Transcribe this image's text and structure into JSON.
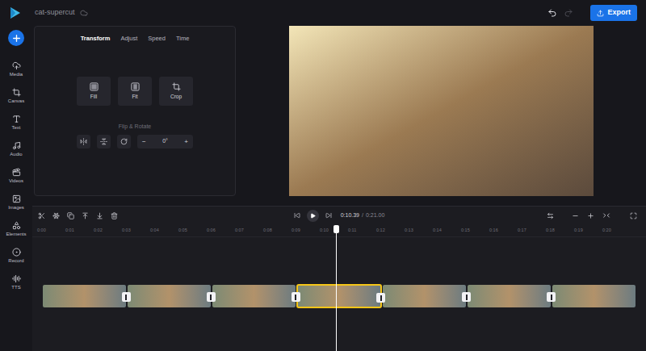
{
  "app": {
    "title": "cat-supercut"
  },
  "toolbar": {
    "undo_disabled": false,
    "redo_disabled": true,
    "export": "Export"
  },
  "sidebar": {
    "items": [
      {
        "label": "Media"
      },
      {
        "label": "Canvas"
      },
      {
        "label": "Text"
      },
      {
        "label": "Audio"
      },
      {
        "label": "Videos"
      },
      {
        "label": "Images"
      },
      {
        "label": "Elements"
      },
      {
        "label": "Record"
      },
      {
        "label": "TTS"
      }
    ]
  },
  "properties": {
    "tabs": [
      {
        "label": "Transform",
        "selected": true
      },
      {
        "label": "Adjust",
        "selected": false
      },
      {
        "label": "Speed",
        "selected": false
      },
      {
        "label": "Time",
        "selected": false
      }
    ],
    "transform_buttons": [
      "Fill",
      "Fit",
      "Crop"
    ],
    "section": "Flip & Rotate",
    "rotation": {
      "decrement": "−",
      "value": "0°",
      "increment": "+"
    }
  },
  "player": {
    "current": "0:10.39",
    "separator": "/",
    "total": "0:21.00"
  },
  "timeline": {
    "ticks": [
      "0:00",
      "0:01",
      "0:02",
      "0:03",
      "0:04",
      "0:05",
      "0:06",
      "0:07",
      "0:08",
      "0:09",
      "0:10",
      "0:11",
      "0:12",
      "0:13",
      "0:14",
      "0:15",
      "0:16",
      "0:17",
      "0:18",
      "0:19",
      "0:20"
    ],
    "playhead": {
      "level": 0.495
    },
    "clips": [
      {
        "selected": false
      },
      {
        "selected": false
      },
      {
        "selected": false
      },
      {
        "selected": true
      },
      {
        "selected": false
      },
      {
        "selected": false
      },
      {
        "selected": false
      }
    ]
  }
}
